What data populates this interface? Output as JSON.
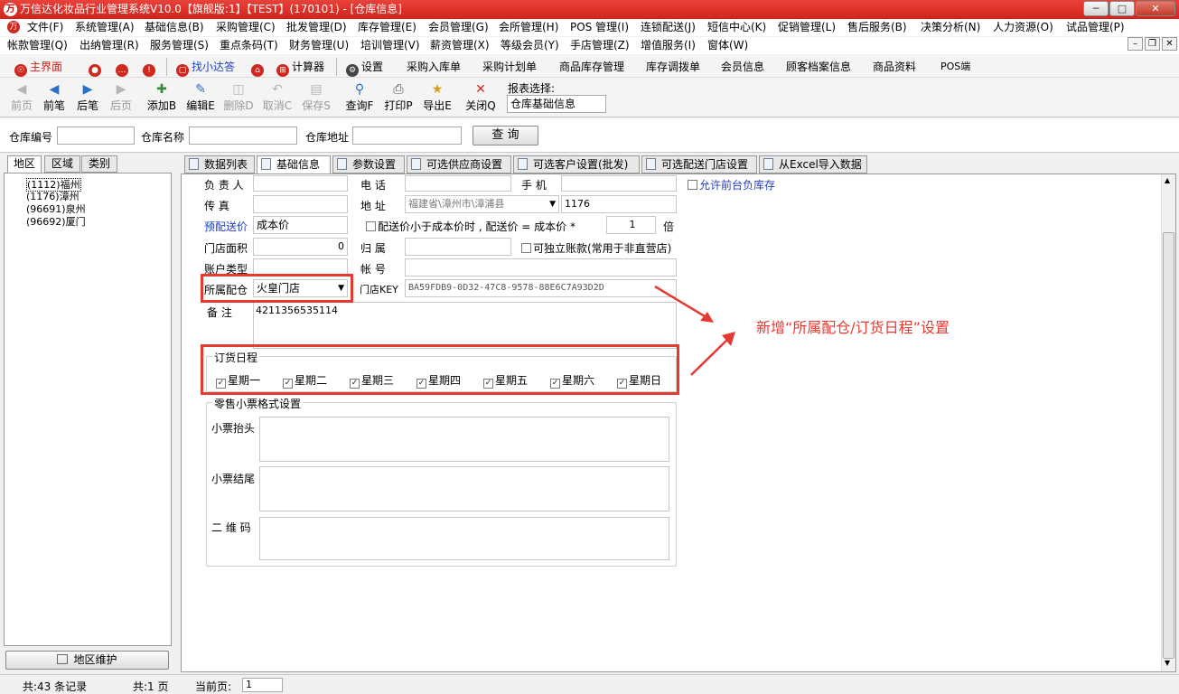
{
  "window": {
    "title": "万信达化妆品行业管理系统V10.0【旗舰版:1】【TEST】(170101) - [仓库信息]",
    "logo_glyph": "万",
    "controls": {
      "minimize": "─",
      "restore": "□",
      "close": "✕"
    }
  },
  "menu1": [
    "文件(F)",
    "系统管理(A)",
    "基础信息(B)",
    "采购管理(C)",
    "批发管理(D)",
    "库存管理(E)",
    "会员管理(G)",
    "会所管理(H)",
    "POS 管理(I)",
    "连锁配送(J)",
    "短信中心(K)",
    "促销管理(L)",
    "售后服务(B)",
    "决策分析(N)",
    "人力资源(O)",
    "试品管理(P)"
  ],
  "menu2": [
    "帐款管理(Q)",
    "出纳管理(R)",
    "服务管理(S)",
    "重点条码(T)",
    "财务管理(U)",
    "培训管理(V)",
    "薪资管理(X)",
    "等级会员(Y)",
    "手店管理(Z)",
    "增值服务(I)",
    "窗体(W)"
  ],
  "mdi_controls": {
    "minimize": "–",
    "restore": "❐",
    "close": "✕"
  },
  "quickbar": {
    "main": "主界面",
    "xiaoda": "找小达答",
    "calc": "计算器",
    "settings": "设置",
    "links": [
      "采购入库单",
      "采购计划单",
      "商品库存管理",
      "库存调拨单",
      "会员信息",
      "顾客档案信息",
      "商品资料",
      "POS端"
    ]
  },
  "toolbar": {
    "prev_first": "前页",
    "prev": "前笔",
    "next": "后笔",
    "next_last": "后页",
    "add": "添加B",
    "edit": "编辑E",
    "delete": "删除D",
    "cancel": "取消C",
    "save": "保存S",
    "query": "查询F",
    "print": "打印P",
    "export": "导出E",
    "close": "关闭Q",
    "report_label": "报表选择:",
    "report_value": "仓库基础信息"
  },
  "search": {
    "code_label": "仓库编号",
    "name_label": "仓库名称",
    "addr_label": "仓库地址",
    "code_value": "",
    "name_value": "",
    "addr_value": "",
    "query_button": "查 询"
  },
  "left": {
    "tabs": [
      "地区",
      "区域",
      "类别"
    ],
    "tree": [
      "(1112)福州",
      "(1176)漳州",
      "(96691)泉州",
      "(96692)厦门"
    ],
    "maint_button": "地区维护"
  },
  "tabs": [
    "数据列表",
    "基础信息",
    "参数设置",
    "可选供应商设置",
    "可选客户设置(批发)",
    "可选配送门店设置",
    "从Excel导入数据"
  ],
  "form": {
    "manager_label": "负 责 人",
    "manager_value": "",
    "phone_label": "电 话",
    "phone_value": "",
    "mobile_label": "手 机",
    "mobile_value": "",
    "allow_negative": "允许前台负库存",
    "fax_label": "传 真",
    "fax_value": "",
    "address_label": "地 址",
    "address_value": "福建省\\漳州市\\漳浦县",
    "address_code": "1176",
    "price_label": "预配送价",
    "price_value": "成本价",
    "price_rule_text": "配送价小于成本价时 , 配送价 = 成本价 *",
    "price_multiplier": "1",
    "price_unit": "倍",
    "area_label": "门店面积",
    "area_value": "0",
    "belong_label": "归 属",
    "belong_value": "",
    "independent_label": "可独立账款(常用于非直营店)",
    "account_type_label": "账户类型",
    "account_type_value": "",
    "account_no_label": "帐 号",
    "account_no_value": "",
    "warehouse_label": "所属配仓",
    "warehouse_value": "火皇门店",
    "store_key_label": "门店KEY",
    "store_key_value": "BA59FDB9-0D32-47C8-9578-88E6C7A93D2D",
    "remark_label": "备 注",
    "remark_value": "4211356535114"
  },
  "schedule": {
    "title": "订货日程",
    "days": [
      "星期一",
      "星期二",
      "星期三",
      "星期四",
      "星期五",
      "星期六",
      "星期日"
    ]
  },
  "receipt": {
    "title": "零售小票格式设置",
    "header_label": "小票抬头",
    "footer_label": "小票结尾",
    "qr_label": "二 维 码"
  },
  "annotation": "新增“所属配仓/订货日程”设置",
  "status": {
    "records": "共:43 条记录",
    "pages": "共:1 页",
    "current_label": "当前页:",
    "current_value": "1"
  },
  "colors": {
    "titlebar": "#d9261d",
    "annotation": "#e53a32",
    "link": "#1f3fbf"
  }
}
